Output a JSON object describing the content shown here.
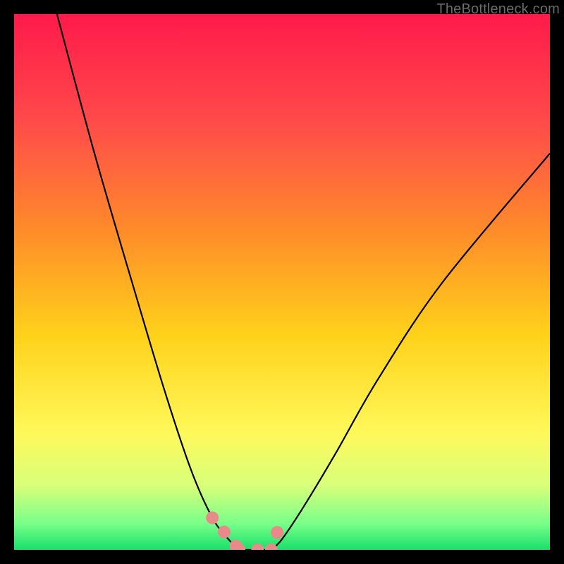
{
  "watermark": "TheBottleneck.com",
  "chart_data": {
    "type": "line",
    "title": "",
    "xlabel": "",
    "ylabel": "",
    "xlim": [
      0,
      100
    ],
    "ylim": [
      0,
      100
    ],
    "series": [
      {
        "name": "curve-left",
        "x": [
          8,
          15,
          22,
          28,
          33,
          37,
          40,
          42
        ],
        "values": [
          100,
          74,
          50,
          30,
          15,
          6,
          2,
          0
        ]
      },
      {
        "name": "curve-right",
        "x": [
          48,
          50,
          54,
          60,
          68,
          80,
          100
        ],
        "values": [
          0,
          2,
          8,
          18,
          32,
          50,
          74
        ]
      }
    ],
    "annotations": [
      {
        "name": "flat-bottom",
        "x": [
          42,
          48
        ],
        "values": [
          0,
          0
        ]
      },
      {
        "name": "pink-marker-left",
        "x": [
          37,
          42
        ],
        "values": [
          6,
          0
        ]
      },
      {
        "name": "pink-marker-bottom",
        "x": [
          42,
          48
        ],
        "values": [
          0,
          0
        ]
      },
      {
        "name": "pink-marker-right",
        "x": [
          48,
          50
        ],
        "values": [
          0,
          6
        ]
      }
    ],
    "gradient_stops": [
      {
        "offset": 0.0,
        "color": "#ff1a4a"
      },
      {
        "offset": 0.2,
        "color": "#ff4a4a"
      },
      {
        "offset": 0.4,
        "color": "#ff8a2a"
      },
      {
        "offset": 0.6,
        "color": "#ffd21a"
      },
      {
        "offset": 0.78,
        "color": "#fff85a"
      },
      {
        "offset": 0.88,
        "color": "#d8ff7a"
      },
      {
        "offset": 0.95,
        "color": "#7aff8a"
      },
      {
        "offset": 1.0,
        "color": "#18e06a"
      }
    ]
  }
}
